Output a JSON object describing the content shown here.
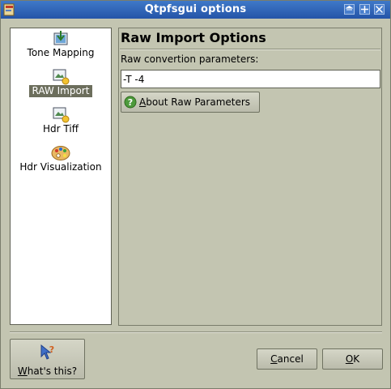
{
  "window": {
    "title": "Qtpfsgui options"
  },
  "sidebar": {
    "items": [
      {
        "label": "Tone Mapping",
        "icon": "tonemap-icon"
      },
      {
        "label": "RAW Import",
        "icon": "raw-import-icon",
        "selected": true
      },
      {
        "label": "Hdr Tiff",
        "icon": "hdr-tiff-icon"
      },
      {
        "label": "Hdr Visualization",
        "icon": "palette-icon"
      }
    ]
  },
  "panel": {
    "title": "Raw Import Options",
    "field_label": "Raw convertion parameters:",
    "field_value": "-T -4",
    "about_button": {
      "mnemonic": "A",
      "rest": "bout Raw Parameters"
    }
  },
  "footer": {
    "whats_this": {
      "mnemonic": "W",
      "rest": "hat's this?"
    },
    "cancel": {
      "mnemonic": "C",
      "rest": "ancel"
    },
    "ok": {
      "mnemonic": "O",
      "rest": "K"
    }
  },
  "colors": {
    "titlebar": "#2f64b6",
    "selection": "#6c6e5c",
    "background": "#c3c5b1"
  }
}
